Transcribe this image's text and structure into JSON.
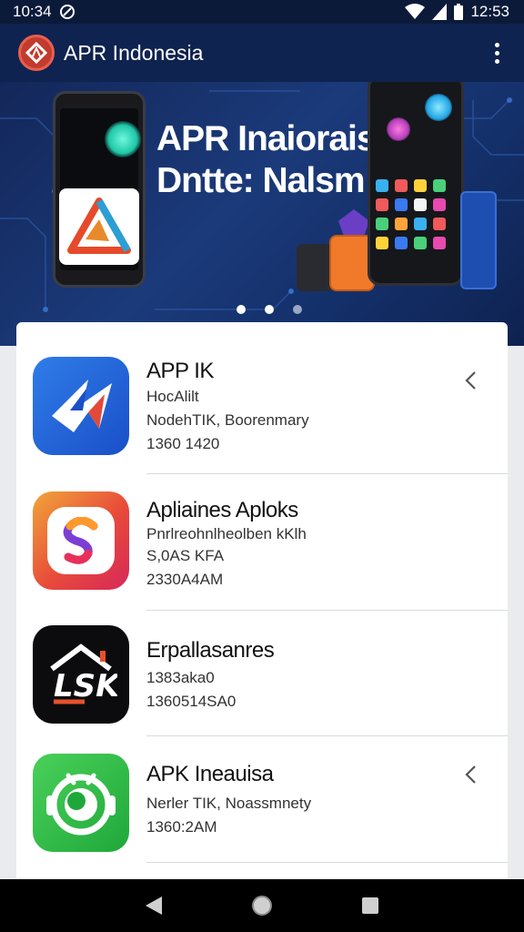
{
  "status_bar": {
    "time_left": "10:34",
    "time_right": "12:53"
  },
  "app_bar": {
    "title": "APR Indonesia"
  },
  "banner": {
    "headline_line1": "APR Inaiorais",
    "headline_line2": "Dntte: Nalsm",
    "slide_count": 3,
    "active_slide": 2
  },
  "apps": [
    {
      "name": "APP IK",
      "line1": "HocAlilt",
      "line2": "NodehTIK, Boorenmary",
      "line3": "1360 1420",
      "icon": "blue-arrow-icon",
      "has_chevron": true
    },
    {
      "name": "Apliaines Aploks",
      "line1": "Pnrlreohnlheolben kKlh",
      "line2": "S,0AS KFA",
      "line3": "2330A4AM",
      "icon": "orange-s-icon",
      "has_chevron": false
    },
    {
      "name": "Erpallasanres",
      "line1": "1383aka0",
      "line2": "1360514SA0",
      "line3": "",
      "icon": "dark-house-icon",
      "has_chevron": false
    },
    {
      "name": "APK Ineauisa",
      "line1": "Nerler TIK, Noassmnety",
      "line2": "1360:2AM",
      "line3": "",
      "icon": "green-robot-icon",
      "has_chevron": true
    }
  ],
  "colors": {
    "app_bar": "#0f2350",
    "status_bar": "#0c1a3a",
    "banner": "#1b3a7a",
    "accent_red": "#c23b2e"
  }
}
